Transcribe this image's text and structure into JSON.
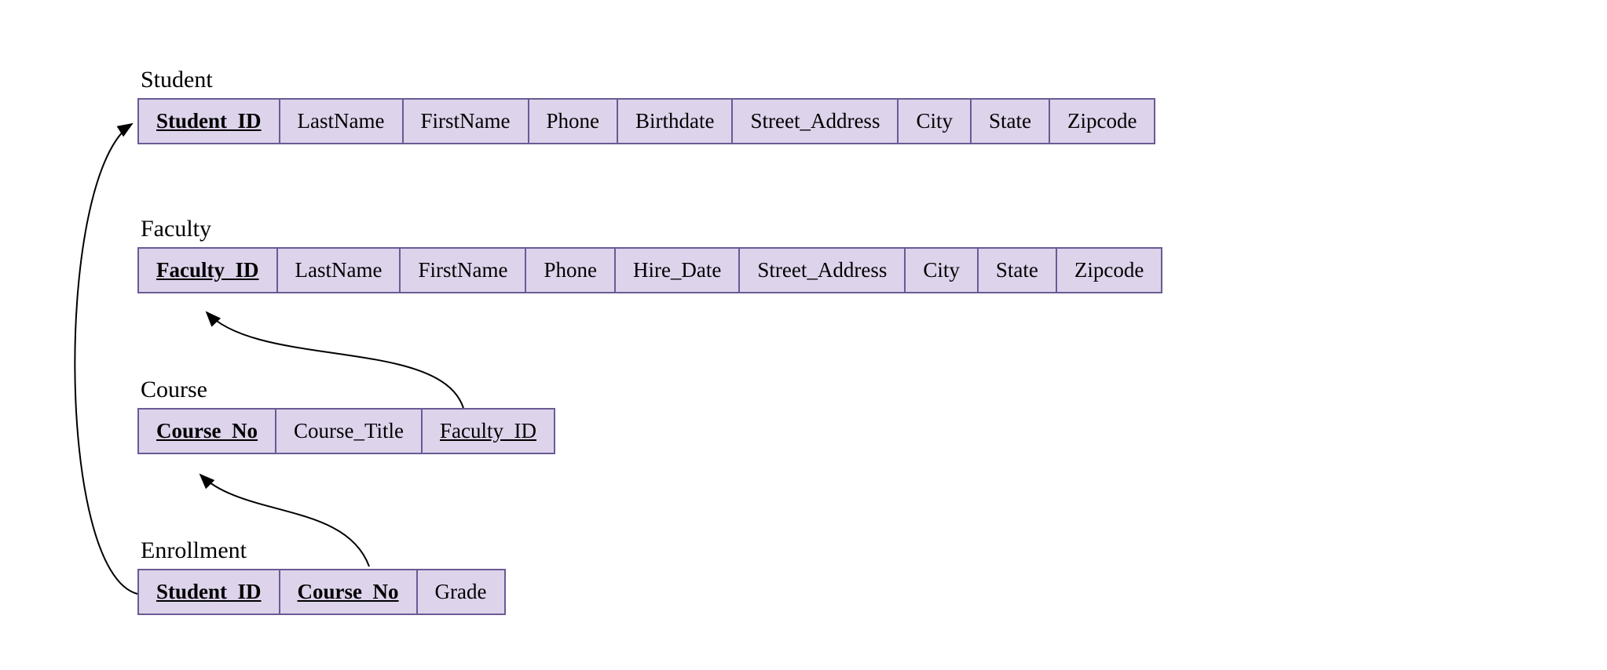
{
  "tables": {
    "student": {
      "title": "Student",
      "fields": [
        {
          "name": "Student_ID",
          "pk": true
        },
        {
          "name": "LastName"
        },
        {
          "name": "FirstName"
        },
        {
          "name": "Phone"
        },
        {
          "name": "Birthdate"
        },
        {
          "name": "Street_Address"
        },
        {
          "name": "City"
        },
        {
          "name": "State"
        },
        {
          "name": "Zipcode"
        }
      ]
    },
    "faculty": {
      "title": "Faculty",
      "fields": [
        {
          "name": "Faculty_ID",
          "pk": true
        },
        {
          "name": "LastName"
        },
        {
          "name": "FirstName"
        },
        {
          "name": "Phone"
        },
        {
          "name": "Hire_Date"
        },
        {
          "name": "Street_Address"
        },
        {
          "name": "City"
        },
        {
          "name": "State"
        },
        {
          "name": "Zipcode"
        }
      ]
    },
    "course": {
      "title": "Course",
      "fields": [
        {
          "name": "Course_No",
          "pk": true
        },
        {
          "name": "Course_Title"
        },
        {
          "name": "Faculty_ID",
          "fk": true
        }
      ]
    },
    "enrollment": {
      "title": "Enrollment",
      "fields": [
        {
          "name": "Student_ID",
          "pk": true
        },
        {
          "name": "Course_No",
          "pk": true
        },
        {
          "name": "Grade"
        }
      ]
    }
  },
  "relationships": [
    {
      "from_table": "Enrollment",
      "from_field": "Student_ID",
      "to_table": "Student",
      "to_field": "Student_ID"
    },
    {
      "from_table": "Enrollment",
      "from_field": "Course_No",
      "to_table": "Course",
      "to_field": "Course_No"
    },
    {
      "from_table": "Course",
      "from_field": "Faculty_ID",
      "to_table": "Faculty",
      "to_field": "Faculty_ID"
    }
  ]
}
